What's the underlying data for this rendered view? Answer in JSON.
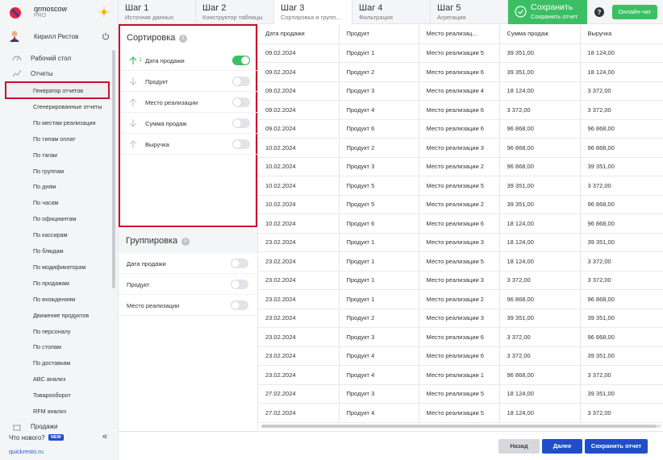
{
  "brand": {
    "name": "qrmoscow",
    "plan": "PRO"
  },
  "user": {
    "name": "Кирилл Рестов"
  },
  "nav": {
    "desktop": "Рабочий стол",
    "reports": "Отчеты",
    "report_items": [
      "Генератор отчетов",
      "Сгенерированные отчеты",
      "По местам реализации",
      "По типам оплат",
      "По тагам",
      "По группам",
      "По дням",
      "По часам",
      "По официантам",
      "По кассирам",
      "По блюдам",
      "По модификаторам",
      "По продажам",
      "По вхождениям",
      "Движение продуктов",
      "По персоналу",
      "По столам",
      "По доставкам",
      "ABC анализ",
      "Товарооборот",
      "RFM анализ"
    ],
    "sales": "Продажи",
    "whats_new": "Что нового?",
    "new_badge": "NEW",
    "site": "quickresto.ru"
  },
  "steps": [
    {
      "title": "Шаг 1",
      "sub": "Источник данных"
    },
    {
      "title": "Шаг 2",
      "sub": "Конструктор таблицы"
    },
    {
      "title": "Шаг 3",
      "sub": "Сортировка и групп..."
    },
    {
      "title": "Шаг 4",
      "sub": "Фильтрация"
    },
    {
      "title": "Шаг 5",
      "sub": "Агрегация"
    }
  ],
  "save_top": {
    "title": "Сохранить",
    "sub": "Сохранить отчет"
  },
  "chat": "Онлайн-чат",
  "sorting": {
    "title": "Сортировка",
    "items": [
      {
        "num": "1",
        "label": "Дата продажи",
        "on": true,
        "dir": "up"
      },
      {
        "num": "",
        "label": "Продукт",
        "on": false,
        "dir": "down"
      },
      {
        "num": "",
        "label": "Место реализации",
        "on": false,
        "dir": "up"
      },
      {
        "num": "",
        "label": "Сумма продаж",
        "on": false,
        "dir": "down"
      },
      {
        "num": "",
        "label": "Выручка",
        "on": false,
        "dir": "up"
      }
    ]
  },
  "grouping": {
    "title": "Группировка",
    "items": [
      {
        "label": "Дата продажи",
        "on": false
      },
      {
        "label": "Продукт",
        "on": false
      },
      {
        "label": "Место реализации",
        "on": false
      }
    ]
  },
  "table": {
    "headers": [
      "Дата продажи",
      "Продукт",
      "Место реализац...",
      "Сумма продаж",
      "Выручка"
    ],
    "rows": [
      [
        "09.02.2024",
        "Продукт 1",
        "Место реализации 5",
        "39 351,00",
        "18 124,00"
      ],
      [
        "09.02.2024",
        "Продукт 2",
        "Место реализации 6",
        "39 351,00",
        "18 124,00"
      ],
      [
        "09.02.2024",
        "Продукт 3",
        "Место реализации 4",
        "18 124,00",
        "3 372,00"
      ],
      [
        "09.02.2024",
        "Продукт 4",
        "Место реализации 6",
        "3 372,00",
        "3 372,00"
      ],
      [
        "09.02.2024",
        "Продукт 6",
        "Место реализации 6",
        "96 868,00",
        "96 868,00"
      ],
      [
        "10.02.2024",
        "Продукт 2",
        "Место реализации 3",
        "96 868,00",
        "96 868,00"
      ],
      [
        "10.02.2024",
        "Продукт 3",
        "Место реализации 2",
        "96 868,00",
        "39 351,00"
      ],
      [
        "10.02.2024",
        "Продукт 5",
        "Место реализации 5",
        "39 351,00",
        "3 372,00"
      ],
      [
        "10.02.2024",
        "Продукт 5",
        "Место реализации 2",
        "39 351,00",
        "96 868,00"
      ],
      [
        "10.02.2024",
        "Продукт 6",
        "Место реализации 6",
        "18 124,00",
        "96 868,00"
      ],
      [
        "23.02.2024",
        "Продукт 1",
        "Место реализации 3",
        "18 124,00",
        "39 351,00"
      ],
      [
        "23.02.2024",
        "Продукт 1",
        "Место реализации 5",
        "18 124,00",
        "3 372,00"
      ],
      [
        "23.02.2024",
        "Продукт 1",
        "Место реализации 3",
        "3 372,00",
        "3 372,00"
      ],
      [
        "23.02.2024",
        "Продукт 1",
        "Место реализации 2",
        "96 868,00",
        "96 868,00"
      ],
      [
        "23.02.2024",
        "Продукт 2",
        "Место реализации 3",
        "39 351,00",
        "39 351,00"
      ],
      [
        "23.02.2024",
        "Продукт 3",
        "Место реализации 6",
        "3 372,00",
        "96 868,00"
      ],
      [
        "23.02.2024",
        "Продукт 4",
        "Место реализации 6",
        "3 372,00",
        "39 351,00"
      ],
      [
        "23.02.2024",
        "Продукт 4",
        "Место реализации 1",
        "96 868,00",
        "3 372,00"
      ],
      [
        "27.02.2024",
        "Продукт 3",
        "Место реализации 5",
        "18 124,00",
        "39 351,00"
      ],
      [
        "27.02.2024",
        "Продукт 4",
        "Место реализации 5",
        "18 124,00",
        "3 372,00"
      ]
    ]
  },
  "footer": {
    "back": "Назад",
    "next": "Далее",
    "save": "Сохранить отчет"
  },
  "colors": {
    "green": "#3bbf63",
    "blue": "#1f4fc8",
    "highlight": "#c8102e"
  }
}
